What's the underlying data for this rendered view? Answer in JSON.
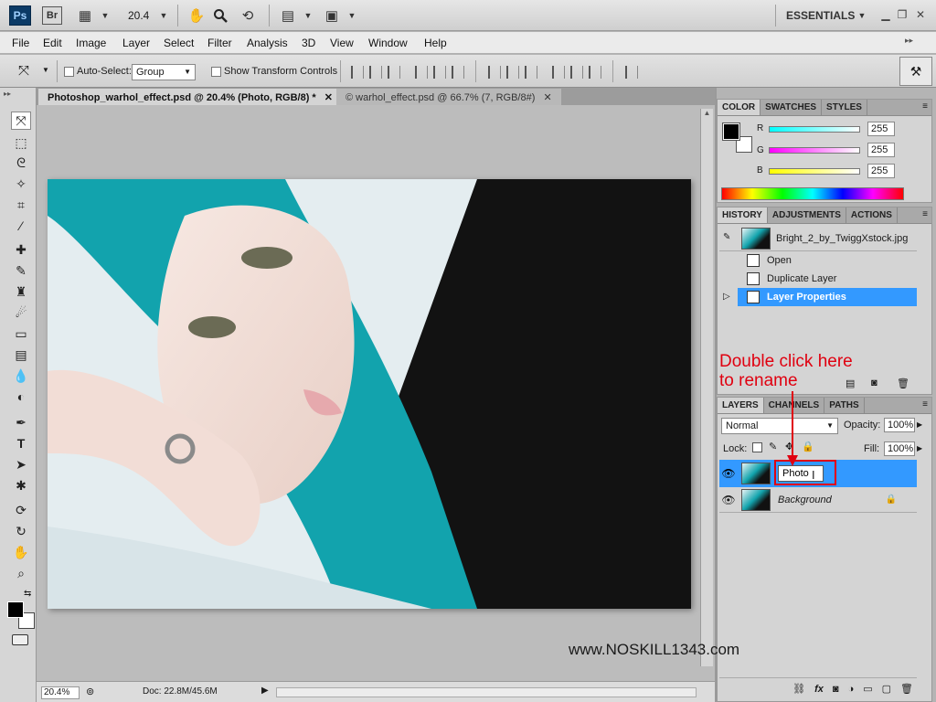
{
  "appbar": {
    "ps_logo": "Ps",
    "br_logo": "Br",
    "zoom": "20.4",
    "workspace": "ESSENTIALS"
  },
  "menu": [
    "File",
    "Edit",
    "Image",
    "Layer",
    "Select",
    "Filter",
    "Analysis",
    "3D",
    "View",
    "Window",
    "Help"
  ],
  "options": {
    "auto_select_label": "Auto-Select:",
    "auto_select_value": "Group",
    "show_transform_label": "Show Transform Controls"
  },
  "tabs": [
    {
      "label": "Photoshop_warhol_effect.psd @ 20.4% (Photo, RGB/8) *"
    },
    {
      "label": "© warhol_effect.psd @ 66.7% (7, RGB/8#)"
    }
  ],
  "status": {
    "zoom": "20.4%",
    "doc": "Doc: 22.8M/45.6M"
  },
  "color_panel": {
    "tabs": [
      "COLOR",
      "SWATCHES",
      "STYLES"
    ],
    "r_label": "R",
    "g_label": "G",
    "b_label": "B",
    "r": "255",
    "g": "255",
    "b": "255"
  },
  "history_panel": {
    "tabs": [
      "HISTORY",
      "ADJUSTMENTS",
      "ACTIONS"
    ],
    "snapshot": "Bright_2_by_TwiggXstock.jpg",
    "steps": [
      "Open",
      "Duplicate Layer",
      "Layer Properties"
    ]
  },
  "layers_panel": {
    "tabs": [
      "LAYERS",
      "CHANNELS",
      "PATHS"
    ],
    "blend_mode": "Normal",
    "opacity_label": "Opacity:",
    "opacity": "100%",
    "lock_label": "Lock:",
    "fill_label": "Fill:",
    "fill": "100%",
    "layers": [
      {
        "name": "Photo"
      },
      {
        "name": "Background"
      }
    ]
  },
  "annotation": {
    "line1": "Double click here",
    "line2": "to rename"
  },
  "watermark": "www.NOSKILL1343.com"
}
